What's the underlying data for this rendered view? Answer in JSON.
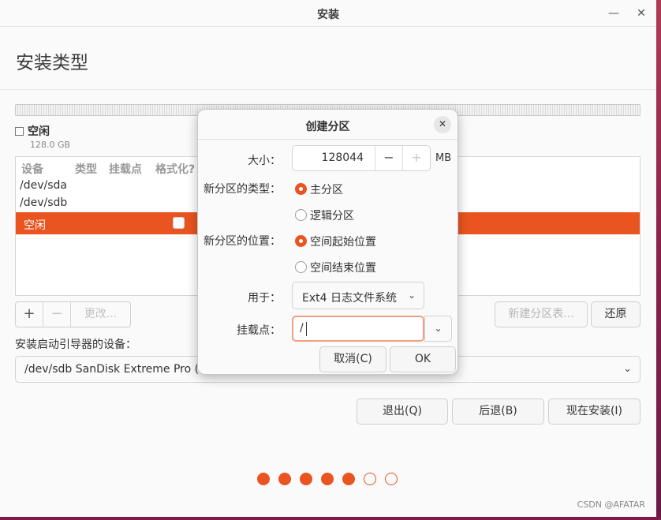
{
  "window": {
    "title": "安装",
    "minimize_glyph": "—",
    "close_glyph": "✕"
  },
  "page": {
    "title": "安装类型"
  },
  "disk": {
    "free_label": "空闲",
    "free_size": "128.0 GB"
  },
  "table": {
    "headers": [
      "设备",
      "类型",
      "挂载点",
      "格式化?"
    ],
    "rows": [
      {
        "device": "/dev/sda"
      },
      {
        "device": "/dev/sdb"
      },
      {
        "device": "空闲",
        "selected": true
      }
    ]
  },
  "toolbar": {
    "add": "+",
    "remove": "−",
    "change": "更改..."
  },
  "actions": {
    "new_table": "新建分区表...",
    "revert": "还原"
  },
  "boot": {
    "label": "安装启动引导器的设备：",
    "value": "/dev/sdb SanDisk Extreme Pro (1"
  },
  "nav": {
    "quit": "退出(Q)",
    "back": "后退(B)",
    "install_now": "现在安装(I)"
  },
  "progress": {
    "total_steps": 7,
    "completed_steps": 5
  },
  "watermark": "CSDN @AFATAR",
  "dialog": {
    "title": "创建分区",
    "size_label": "大小：",
    "size_value": "128044",
    "size_unit": "MB",
    "minus": "−",
    "plus": "+",
    "type_label": "新分区的类型：",
    "type_options": [
      {
        "label": "主分区",
        "selected": true
      },
      {
        "label": "逻辑分区",
        "selected": false
      }
    ],
    "location_label": "新分区的位置：",
    "location_options": [
      {
        "label": "空间起始位置",
        "selected": true
      },
      {
        "label": "空间结束位置",
        "selected": false
      }
    ],
    "use_label": "用于：",
    "use_value": "Ext4 日志文件系统",
    "mount_label": "挂载点：",
    "mount_value": "/",
    "cancel": "取消(C)",
    "ok": "OK"
  },
  "colors": {
    "accent": "#e95420",
    "desktop": "#8a1f4a"
  },
  "icons": {
    "close": "close-icon",
    "chevron": "chevron-down-icon"
  }
}
